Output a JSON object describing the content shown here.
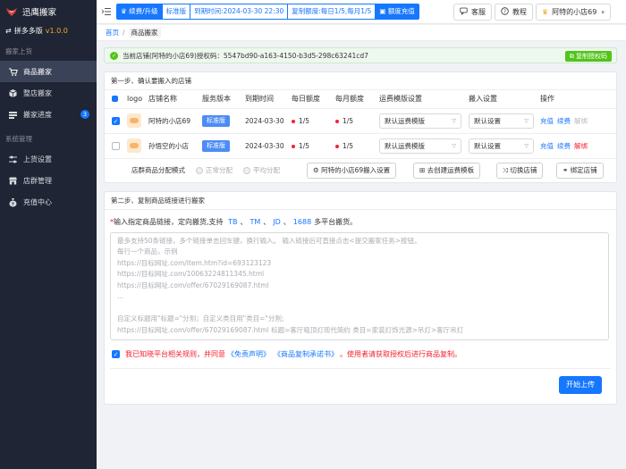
{
  "app": {
    "name": "迅鹰搬家",
    "platform": "拼多多版",
    "version": "v1.0.0"
  },
  "sidebar": {
    "sections": [
      {
        "label": "搬家上货",
        "items": [
          {
            "label": "商品搬家",
            "icon": "cart-icon",
            "active": true
          },
          {
            "label": "整店搬家",
            "icon": "box-icon"
          },
          {
            "label": "搬家进度",
            "icon": "progress-icon",
            "badge": "3"
          }
        ]
      },
      {
        "label": "系统管理",
        "items": [
          {
            "label": "上货设置",
            "icon": "sliders-icon"
          },
          {
            "label": "店群管理",
            "icon": "store-icon"
          },
          {
            "label": "充值中心",
            "icon": "money-bag-icon"
          }
        ]
      }
    ]
  },
  "topbar": {
    "renew": "续费/升级",
    "edition": "标准版",
    "expire": "到期时间:2024-03-30 22:30",
    "quota": "复制额度:每日1/5,每月1/5",
    "recharge": "额度充值",
    "service": "客服",
    "tutorial": "教程",
    "store": "阿特的小店69"
  },
  "breadcrumb": {
    "home": "首页",
    "current": "商品搬家"
  },
  "alert": {
    "text": "当前店铺(阿特的小店69)授权码：5547bd90-a163-4150-b3d5-298c63241cd7",
    "copy": "复制授权码"
  },
  "step1": {
    "title": "第一步、确认要搬入的店铺",
    "columns": [
      "logo",
      "店铺名称",
      "服务版本",
      "到期时间",
      "每日额度",
      "每月额度",
      "运费模版设置",
      "搬入设置",
      "操作"
    ],
    "rows": [
      {
        "name": "阿特的小店69",
        "version": "标准版",
        "expire": "2024-03-30",
        "daily": "1/5",
        "monthly": "1/5",
        "freight": "默认运费模版",
        "move": "默认设置",
        "checked": true,
        "actions": [
          "充值",
          "续费",
          "解绑"
        ]
      },
      {
        "name": "孙悟空的小店",
        "version": "标准版",
        "expire": "2024-03-30",
        "daily": "1/5",
        "monthly": "1/5",
        "freight": "默认运费模版",
        "move": "默认设置",
        "checked": false,
        "actions": [
          "充值",
          "续费",
          "解绑"
        ]
      }
    ],
    "mode_label": "店群商品分配模式",
    "mode_options": [
      "正常分配",
      "平均分配"
    ],
    "buttons": {
      "settings": "阿特的小店69搬入设置",
      "freight": "去创建运费模板",
      "switch": "切换店铺",
      "bind": "绑定店铺"
    }
  },
  "step2": {
    "title": "第二步、复制商品链接进行搬家",
    "instruction_prefix": "输入指定商品链接，定向搬货,支持",
    "platforms": [
      "TB",
      "TM",
      "JD",
      "1688"
    ],
    "instruction_suffix": "多平台搬货。",
    "placeholder": "最多支持50条链接，多个链接单击回车键，换行输入。 输入链接后可直接点击<提交搬家任务>按钮。\n每行一个商品，示例\nhttps://目标网址.com/item.htm?id=693123123\nhttps://目标网址.com/10063224811345.html\nhttps://目标网址.com/offer/67029169087.html\n...\n\n自定义标题用\"标题=\"分割；自定义类目用\"类目=\"分割;\nhttps://目标网址.com/offer/67029169087.html 标题=客厅吸顶灯现代简约 类目=家装灯饰光源>吊灯>客厅吊灯",
    "agree_prefix": "我已知晓平台相关规则，并同意",
    "agree_link1": "《免责声明》",
    "agree_link2": "《商品复制承诺书》",
    "agree_suffix": "。使用者请获取授权后进行商品复制。",
    "upload": "开始上传"
  }
}
